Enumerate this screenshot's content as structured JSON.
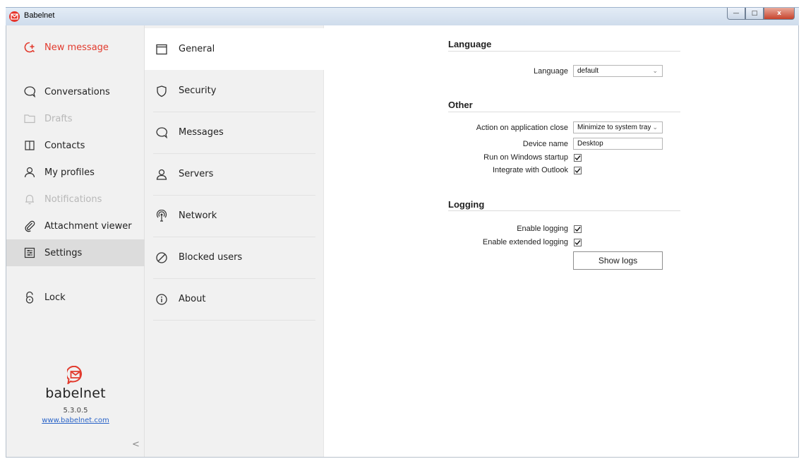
{
  "window": {
    "title": "Babelnet",
    "controls": {
      "minimize": "—",
      "maximize": "□",
      "close": "x"
    }
  },
  "sidebar": {
    "new_message": "New message",
    "items": [
      {
        "label": "Conversations",
        "icon": "conversations-icon",
        "enabled": true
      },
      {
        "label": "Drafts",
        "icon": "folder-icon",
        "enabled": false
      },
      {
        "label": "Contacts",
        "icon": "book-icon",
        "enabled": true
      },
      {
        "label": "My profiles",
        "icon": "person-icon",
        "enabled": true
      },
      {
        "label": "Notifications",
        "icon": "bell-icon",
        "enabled": false
      },
      {
        "label": "Attachment viewer",
        "icon": "paperclip-icon",
        "enabled": true
      },
      {
        "label": "Settings",
        "icon": "sliders-icon",
        "enabled": true,
        "active": true
      }
    ],
    "lock": "Lock",
    "brand": {
      "name": "babelnet",
      "version": "5.3.0.5",
      "link": "www.babelnet.com"
    },
    "collapse": "<"
  },
  "settings_nav": {
    "items": [
      {
        "label": "General",
        "icon": "window-icon",
        "active": true
      },
      {
        "label": "Security",
        "icon": "shield-icon"
      },
      {
        "label": "Messages",
        "icon": "chat-icon"
      },
      {
        "label": "Servers",
        "icon": "person-icon"
      },
      {
        "label": "Network",
        "icon": "network-icon"
      },
      {
        "label": "Blocked users",
        "icon": "blocked-icon"
      },
      {
        "label": "About",
        "icon": "info-icon"
      }
    ]
  },
  "general": {
    "language_section": {
      "title": "Language",
      "language_label": "Language",
      "language_value": "default"
    },
    "other_section": {
      "title": "Other",
      "action_label": "Action on application close",
      "action_value": "Minimize to system tray",
      "device_label": "Device name",
      "device_value": "Desktop",
      "startup_label": "Run on Windows startup",
      "startup_checked": true,
      "outlook_label": "Integrate with Outlook",
      "outlook_checked": true
    },
    "logging_section": {
      "title": "Logging",
      "enable_label": "Enable logging",
      "enable_checked": true,
      "extended_label": "Enable extended logging",
      "extended_checked": true,
      "show_logs": "Show logs"
    }
  },
  "colors": {
    "accent": "#e23b2e",
    "sidebar_bg": "#f1f1f1",
    "active_bg": "#dcdcdc",
    "link": "#2a64c8"
  }
}
